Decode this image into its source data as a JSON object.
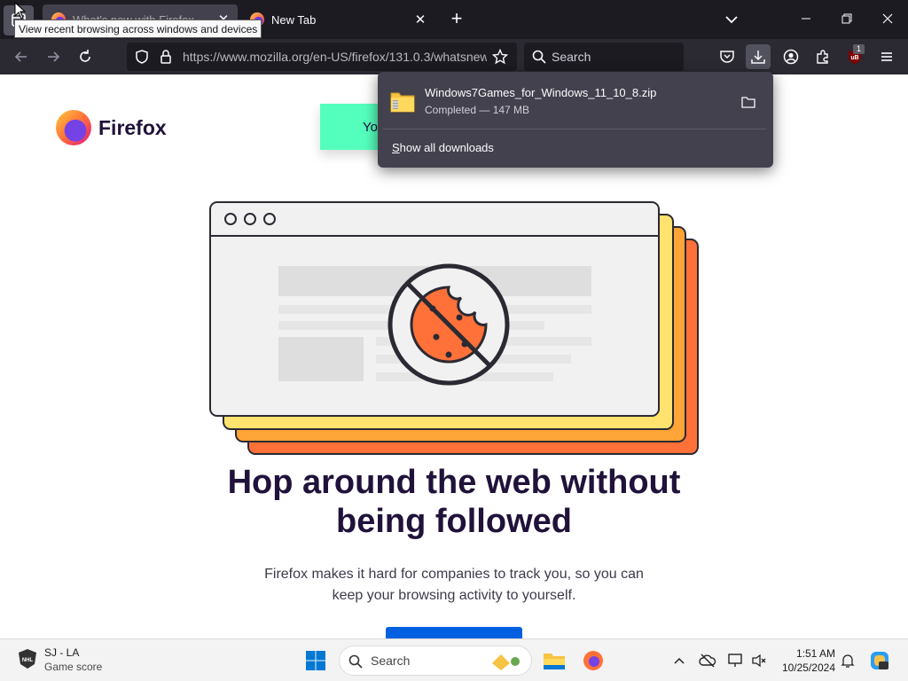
{
  "window": {
    "tooltip": "View recent browsing across windows and devices",
    "tabs": [
      {
        "title": "What's new with Firefox",
        "active": true
      },
      {
        "title": "New Tab",
        "active": false
      }
    ]
  },
  "navbar": {
    "url_host": "https://www.mozilla.org",
    "url_path": "/en-US/firefox/131.0.3/whatsnew/",
    "search_placeholder": "Search",
    "extension_badge": "1"
  },
  "downloads_panel": {
    "filename": "Windows7Games_for_Windows_11_10_8.zip",
    "status": "Completed — 147 MB",
    "show_all": "Show all downloads"
  },
  "page": {
    "brand": "Firefox",
    "cta_partial": "Yo",
    "headline_line1": "Hop around the web without",
    "headline_line2": "being followed",
    "subtext_line1": "Firefox makes it hard for companies to track you, so you can",
    "subtext_line2": "keep your browsing activity to yourself."
  },
  "taskbar": {
    "widget_title": "SJ - LA",
    "widget_subtitle": "Game score",
    "search_placeholder": "Search",
    "time": "1:51 AM",
    "date": "10/25/2024"
  },
  "colors": {
    "titlebar": "#1c1b22",
    "toolbar": "#2b2a33",
    "headline": "#20123a",
    "cta_green": "#54ffbd",
    "button_blue": "#0060df"
  }
}
